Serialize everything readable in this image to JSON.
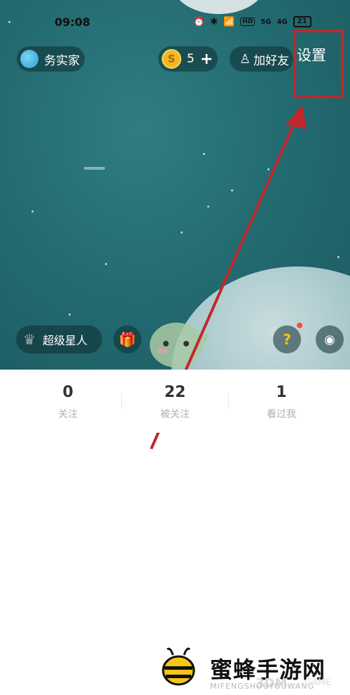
{
  "status_bar": {
    "time": "09:08",
    "icons_text": [
      "⏰",
      "✱",
      "📶",
      "HD",
      "5G",
      "4G"
    ],
    "battery": "21"
  },
  "header": {
    "profile_name": "务实家",
    "coins": "5",
    "add_friend_label": "加好友",
    "settings_label": "设置"
  },
  "hero_bottom": {
    "super_star_label": "超级星人"
  },
  "stats": [
    {
      "value": "0",
      "label": "关注"
    },
    {
      "value": "22",
      "label": "被关注"
    },
    {
      "value": "1",
      "label": "看过我"
    }
  ],
  "watermark": {
    "title": "蜜蜂手游网",
    "subtitle": "MIFENGSHOUYOUWANG",
    "brand": "3DM",
    "game": "GAME"
  },
  "colors": {
    "hero_bg": "#236c72",
    "highlight": "#c0282b",
    "coin": "#f2b824"
  }
}
